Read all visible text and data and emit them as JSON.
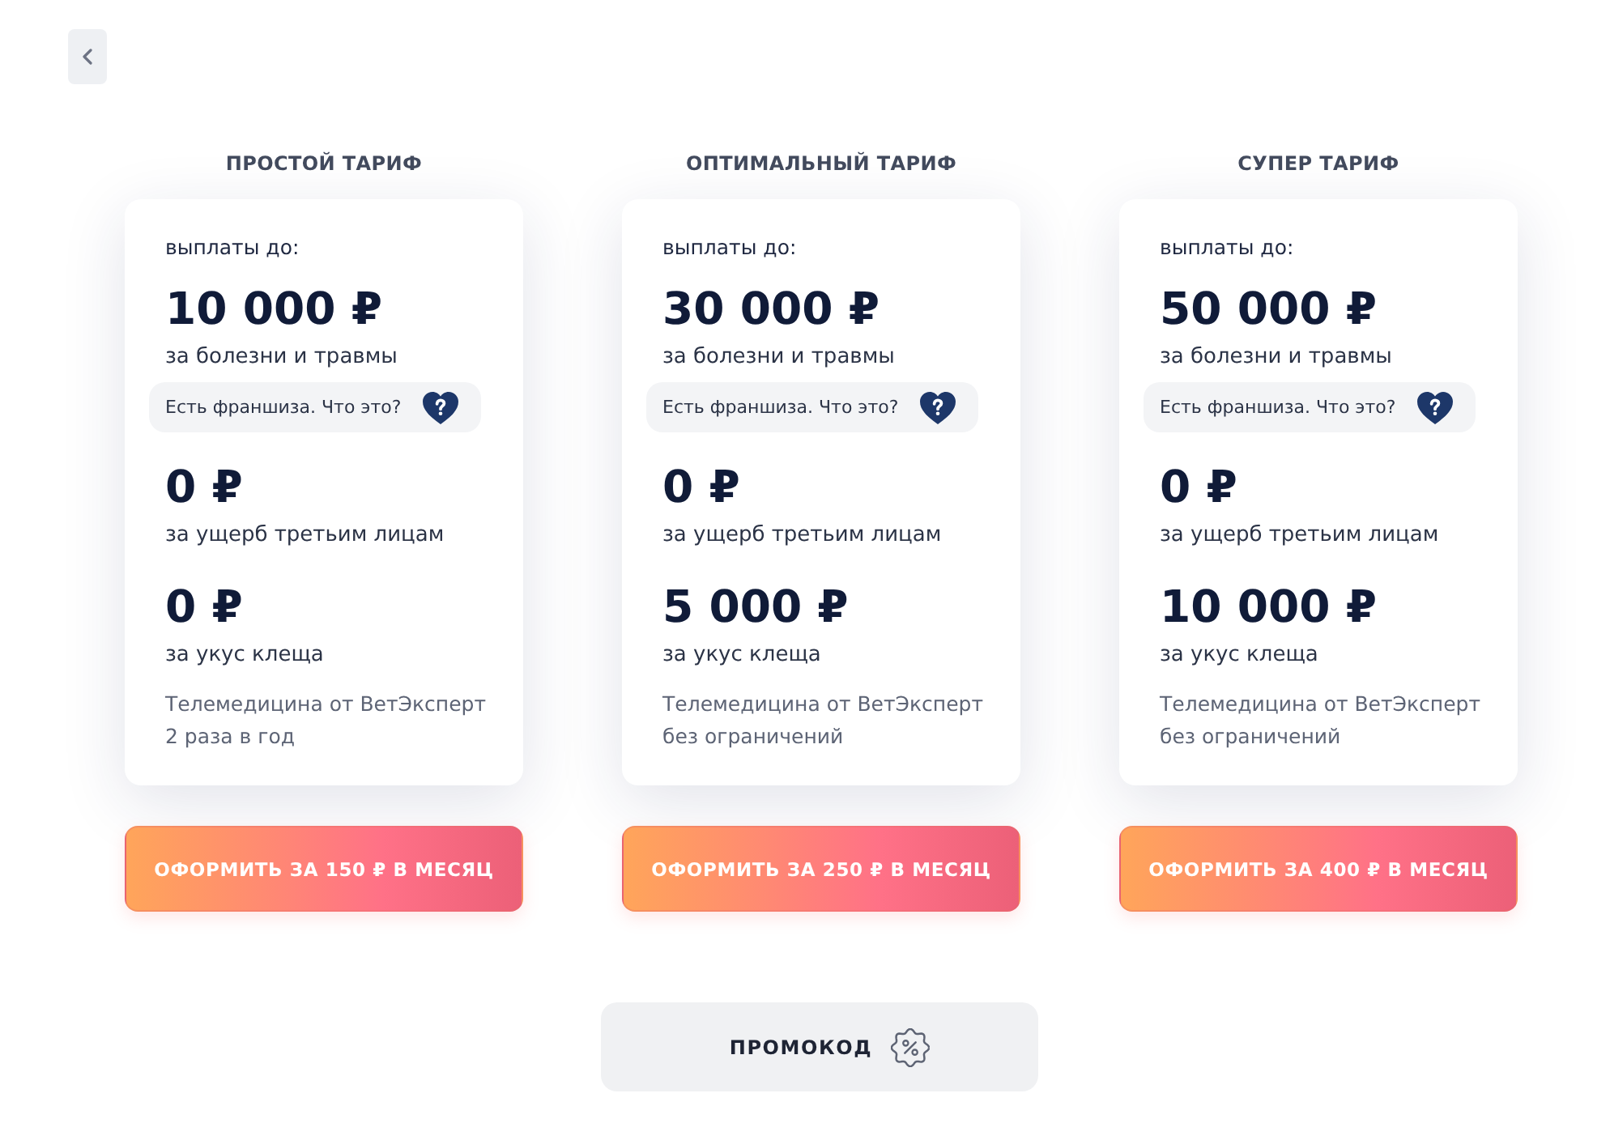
{
  "plans": [
    {
      "title": "ПРОСТОЙ ТАРИФ",
      "payout_label": "выплаты до:",
      "rows": [
        {
          "kind": "amount",
          "amount": "10 000 ₽",
          "caption": "за болезни и травмы"
        },
        {
          "kind": "note",
          "text": "Есть франшиза. Что это?"
        },
        {
          "kind": "amount",
          "amount": "0 ₽",
          "caption": "за ущерб третьим лицам"
        },
        {
          "kind": "amount",
          "amount": "0 ₽",
          "caption": "за укус клеща"
        },
        {
          "kind": "text",
          "lines": [
            "Телемедицина от ВетЭксперт",
            "2 раза в год"
          ]
        }
      ],
      "button": "ОФОРМИТЬ ЗА 150 ₽ В МЕСЯЦ"
    },
    {
      "title": "ОПТИМАЛЬНЫЙ ТАРИФ",
      "payout_label": "выплаты до:",
      "rows": [
        {
          "kind": "amount",
          "amount": "30 000 ₽",
          "caption": "за болезни и травмы"
        },
        {
          "kind": "note",
          "text": "Есть франшиза. Что это?"
        },
        {
          "kind": "amount",
          "amount": "0 ₽",
          "caption": "за ущерб третьим лицам"
        },
        {
          "kind": "amount",
          "amount": "5 000 ₽",
          "caption": "за укус клеща"
        },
        {
          "kind": "text",
          "lines": [
            "Телемедицина от ВетЭксперт",
            "без ограничений"
          ]
        }
      ],
      "button": "ОФОРМИТЬ ЗА 250 ₽ В МЕСЯЦ"
    },
    {
      "title": "СУПЕР ТАРИФ",
      "payout_label": "выплаты до:",
      "rows": [
        {
          "kind": "amount",
          "amount": "50 000 ₽",
          "caption": "за болезни и травмы"
        },
        {
          "kind": "note",
          "text": "Есть франшиза. Что это?"
        },
        {
          "kind": "amount",
          "amount": "0 ₽",
          "caption": "за ущерб третьим лицам"
        },
        {
          "kind": "amount",
          "amount": "10 000 ₽",
          "caption": "за укус клеща"
        },
        {
          "kind": "text",
          "lines": [
            "Телемедицина от ВетЭксперт",
            "без ограничений"
          ]
        }
      ],
      "button": "ОФОРМИТЬ ЗА 400 ₽ В МЕСЯЦ"
    }
  ],
  "promo_button": {
    "label": "ПРОМОКОД"
  }
}
